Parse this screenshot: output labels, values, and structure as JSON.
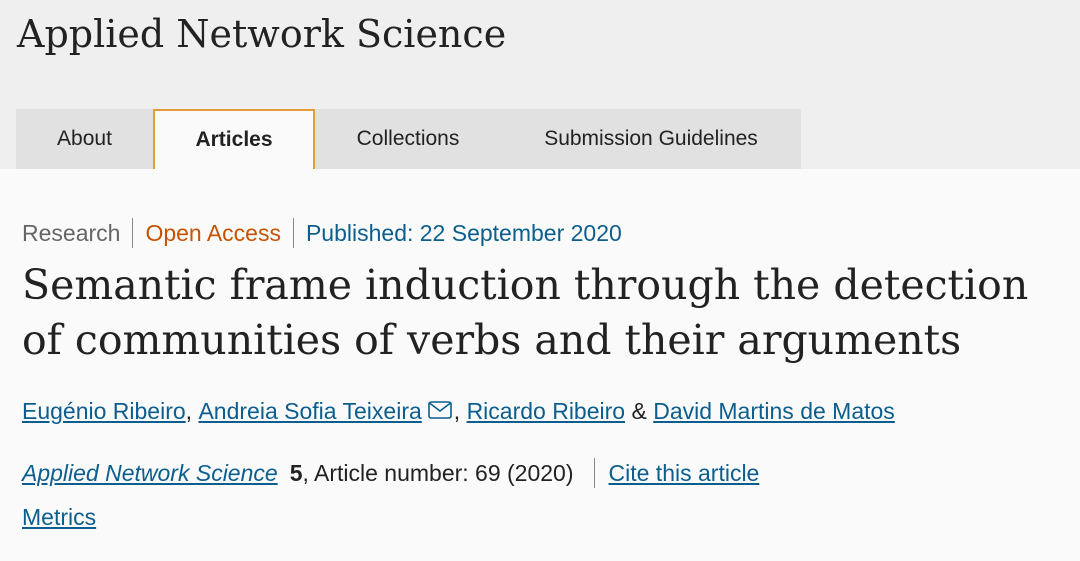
{
  "journal": {
    "title": "Applied Network Science"
  },
  "nav": {
    "tabs": [
      {
        "label": "About"
      },
      {
        "label": "Articles",
        "active": true
      },
      {
        "label": "Collections"
      },
      {
        "label": "Submission Guidelines"
      }
    ]
  },
  "article": {
    "type": "Research",
    "access": "Open Access",
    "published": "Published: 22 September 2020",
    "title": "Semantic frame induction through the detection of communities of verbs and their arguments",
    "authors": [
      "Eugénio Ribeiro",
      "Andreia Sofia Teixeira",
      "Ricardo Ribeiro",
      "David Martins de Matos"
    ],
    "author_sep_comma": ",",
    "author_sep_and": "&",
    "journal_name": "Applied Network Science",
    "volume": "5",
    "article_number": ", Article number: 69 (2020)",
    "cite_label": "Cite this article",
    "metrics_label": "Metrics"
  },
  "colors": {
    "accent_orange": "#e59a3c",
    "link_blue": "#0b5e8d",
    "open_access": "#c65301"
  }
}
